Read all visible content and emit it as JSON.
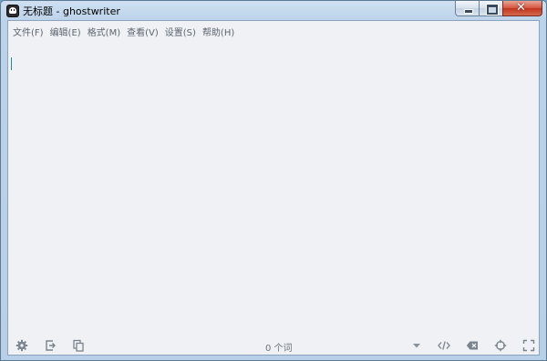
{
  "window": {
    "title": "无标题 - ghostwriter",
    "close_glyph": "✕"
  },
  "menu": {
    "items": [
      {
        "label": "文件(F)"
      },
      {
        "label": "编辑(E)"
      },
      {
        "label": "格式(M)"
      },
      {
        "label": "查看(V)"
      },
      {
        "label": "设置(S)"
      },
      {
        "label": "帮助(H)"
      }
    ]
  },
  "editor": {
    "content": ""
  },
  "status": {
    "word_count": "0 个词",
    "icons": {
      "settings": "gear-icon",
      "export": "export-icon",
      "copy": "copy-html-icon",
      "dropdown": "chevron-down-icon",
      "html_preview": "code-icon",
      "hemingway": "backspace-icon",
      "focus": "crosshair-icon",
      "fullscreen": "fullscreen-icon"
    }
  },
  "colors": {
    "titlebar": "#bcd3ea",
    "client_bg": "#eff1f4",
    "menu_text": "#5c6670",
    "caret": "#2a8a9a",
    "icon": "#7a848e",
    "close_button": "#c2351d"
  }
}
